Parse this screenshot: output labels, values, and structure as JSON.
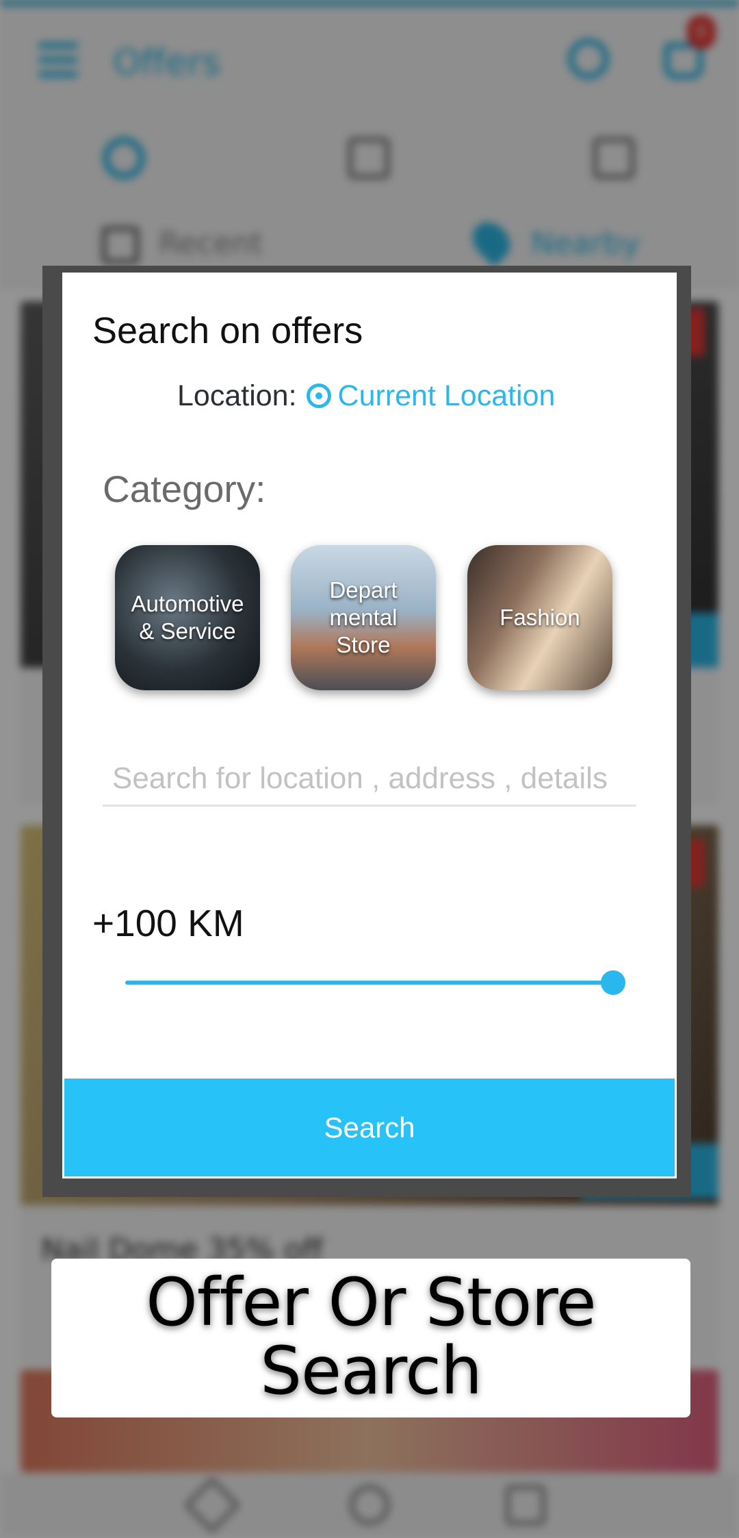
{
  "background": {
    "app_title": "Offers",
    "cart_badge": "0",
    "filters": {
      "recent": "Recent",
      "nearby": "Nearby"
    },
    "card_title": "Nail Dome 35% off"
  },
  "dialog": {
    "title": "Search on offers",
    "location_label": "Location:",
    "location_value": "Current Location",
    "category_label": "Category:",
    "categories": [
      {
        "label": "Automotive & Service"
      },
      {
        "label": "Depart mental Store"
      },
      {
        "label": "Fashion"
      }
    ],
    "search_placeholder": "Search for location , address , details",
    "distance_label": "+100 KM",
    "distance_value_fraction": 1.0,
    "search_button": "Search"
  },
  "caption": "Offer Or Store Search",
  "colors": {
    "accent": "#29b7ee",
    "button": "#26c2f8",
    "title_text": "#111111",
    "label_gray": "#6a6a6a"
  }
}
